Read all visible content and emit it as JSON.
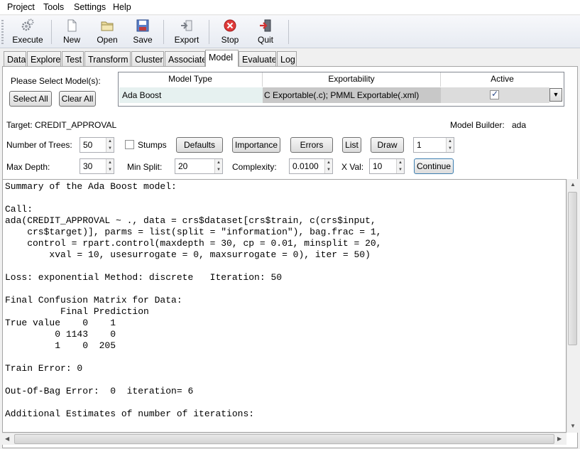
{
  "menu": [
    "Project",
    "Tools",
    "Settings",
    "Help"
  ],
  "toolbar": {
    "execute": "Execute",
    "new": "New",
    "open": "Open",
    "save": "Save",
    "export": "Export",
    "stop": "Stop",
    "quit": "Quit"
  },
  "tabs": [
    "Data",
    "Explore",
    "Test",
    "Transform",
    "Cluster",
    "Associate",
    "Model",
    "Evaluate",
    "Log"
  ],
  "model_select": {
    "prompt": "Please Select Model(s):",
    "select_all": "Select All",
    "clear_all": "Clear All",
    "headers": [
      "Model Type",
      "Exportability",
      "Active"
    ],
    "row": {
      "type": "Ada Boost",
      "exportability": "C Exportable(.c); PMML Exportable(.xml)"
    }
  },
  "target": "Target: CREDIT_APPROVAL",
  "model_builder_label": "Model Builder:",
  "model_builder_value": "ada",
  "params": {
    "num_trees_label": "Number of Trees:",
    "num_trees": "50",
    "stumps_label": "Stumps",
    "defaults": "Defaults",
    "importance": "Importance",
    "errors": "Errors",
    "list": "List",
    "draw": "Draw",
    "draw_value": "1",
    "max_depth_label": "Max Depth:",
    "max_depth": "30",
    "min_split_label": "Min Split:",
    "min_split": "20",
    "complexity_label": "Complexity:",
    "complexity": "0.0100",
    "xval_label": "X Val:",
    "xval": "10",
    "continue": "Continue"
  },
  "output": "Summary of the Ada Boost model:\n\nCall:\nada(CREDIT_APPROVAL ~ ., data = crs$dataset[crs$train, c(crs$input,\n    crs$target)], parms = list(split = \"information\"), bag.frac = 1,\n    control = rpart.control(maxdepth = 30, cp = 0.01, minsplit = 20,\n        xval = 10, usesurrogate = 0, maxsurrogate = 0), iter = 50)\n\nLoss: exponential Method: discrete   Iteration: 50\n\nFinal Confusion Matrix for Data:\n          Final Prediction\nTrue value    0    1\n         0 1143    0\n         1    0  205\n\nTrain Error: 0\n\nOut-Of-Bag Error:  0  iteration= 6\n\nAdditional Estimates of number of iterations:"
}
